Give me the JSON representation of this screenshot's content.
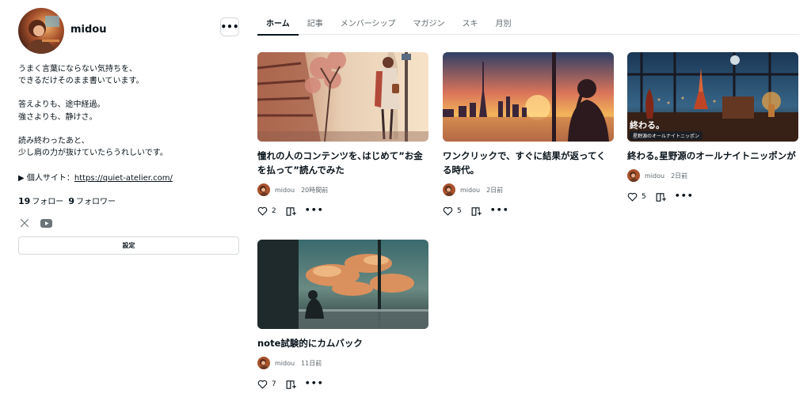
{
  "profile": {
    "username": "midou",
    "more_label": "•••",
    "bio_lines": [
      "うまく言葉にならない気持ちを、",
      "できるだけそのまま書いています。",
      "",
      "答えよりも、途中経過。",
      "強さよりも、静けさ。",
      "",
      "読み終わったあと、",
      "少し肩の力が抜けていたらうれしいです。"
    ],
    "site_label": "▶ 個人サイト：",
    "site_url": "https://quiet-atelier.com/",
    "following_count": "19",
    "following_label": "フォロー",
    "followers_count": "9",
    "followers_label": "フォロワー",
    "social": [
      {
        "icon": "x-icon",
        "glyph": "𝕏"
      },
      {
        "icon": "youtube-icon"
      }
    ],
    "settings_label": "設定"
  },
  "tabs": [
    {
      "label": "ホーム",
      "active": true
    },
    {
      "label": "記事",
      "active": false
    },
    {
      "label": "メンバーシップ",
      "active": false
    },
    {
      "label": "マガジン",
      "active": false
    },
    {
      "label": "スキ",
      "active": false
    },
    {
      "label": "月別",
      "active": false
    }
  ],
  "articles": [
    {
      "title": "憧れの人のコンテンツを､はじめて”お金を払って”読んでみた",
      "author": "midou",
      "time": "20時間前",
      "likes": "2",
      "thumb": "street-girl-illustration"
    },
    {
      "title": "ワンクリックで、すぐに結果が返ってくる時代。",
      "author": "midou",
      "time": "2日前",
      "likes": "5",
      "thumb": "tokyo-sunset-illustration"
    },
    {
      "title": "終わる｡星野源のオールナイトニッポンが",
      "author": "midou",
      "time": "2日前",
      "likes": "5",
      "thumb": "night-room-illustration",
      "thumb_caption_big": "終わる。",
      "thumb_caption_small": "星野源のオールナイトニッポン"
    },
    {
      "title": "note試験的にカムバック",
      "author": "midou",
      "time": "11日前",
      "likes": "7",
      "thumb": "sunset-window-illustration"
    }
  ],
  "colors": {
    "text": "#08131a",
    "muted": "#5d666b",
    "border": "#d4d8da"
  }
}
